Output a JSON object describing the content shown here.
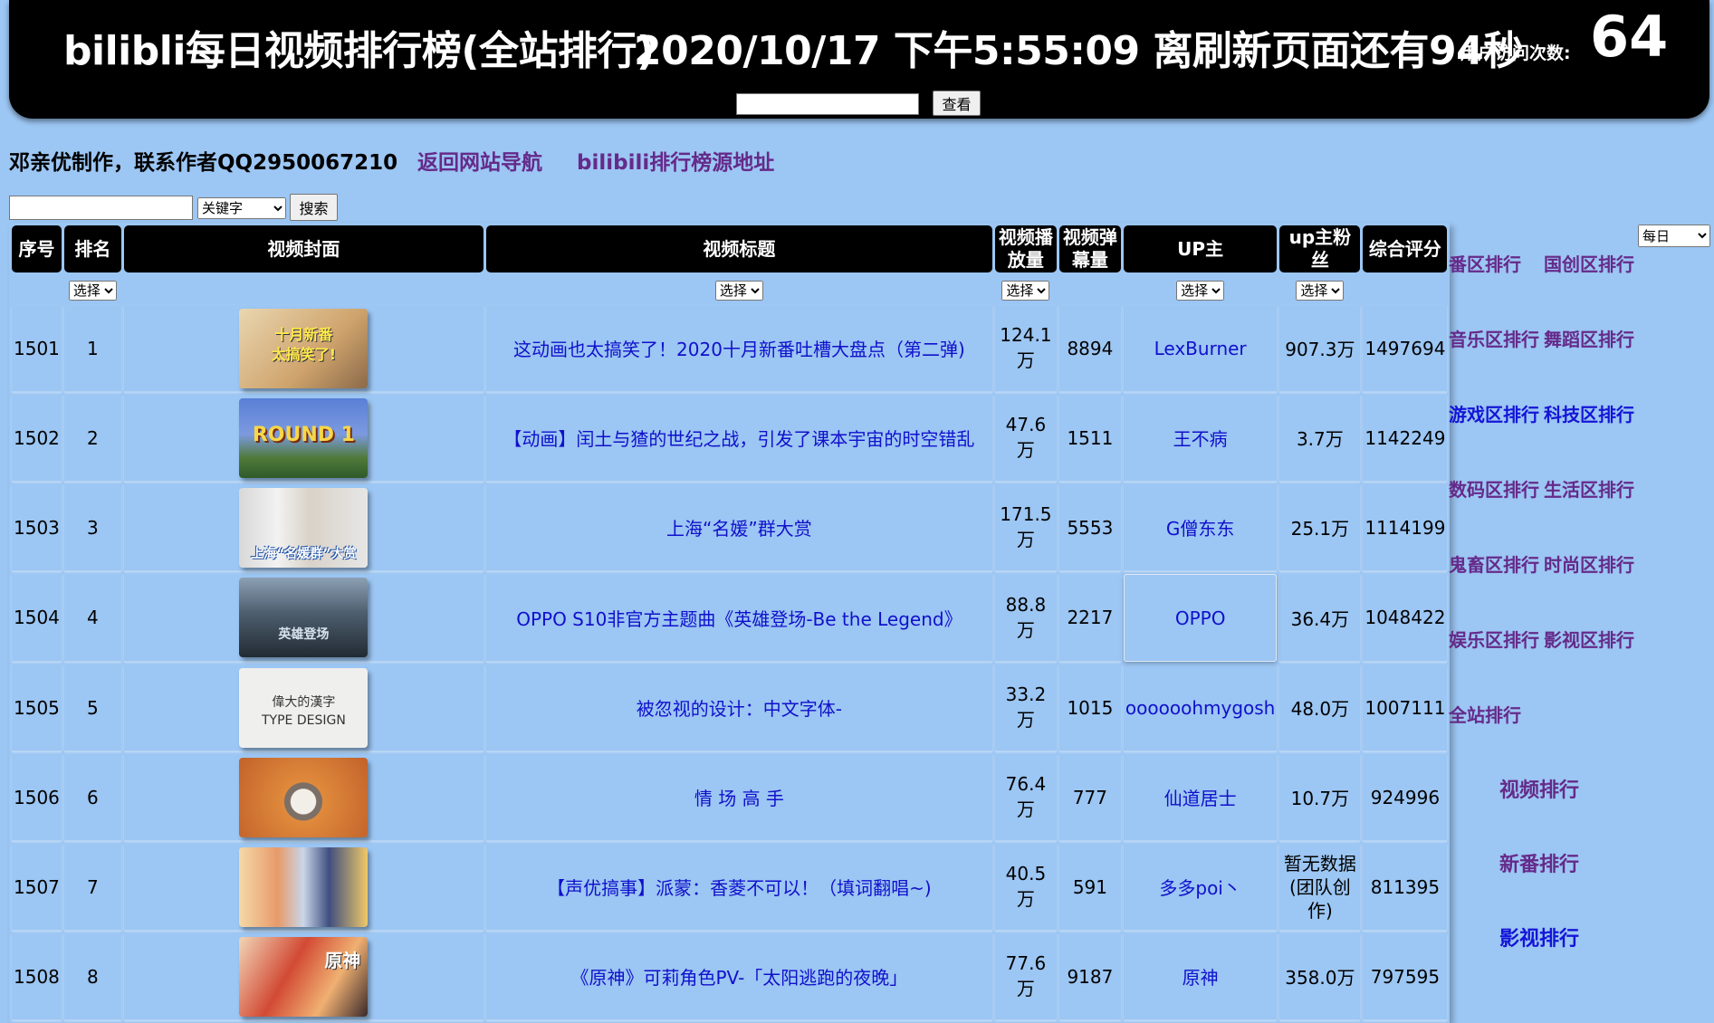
{
  "header": {
    "title": "bilibli每日视频排行榜(全站排行)",
    "clock": "2020/10/17 下午5:55:09 离刷新页面还有94秒",
    "visits_label": "用户访问次数:",
    "visits_count": "64",
    "view_button": "查看",
    "view_input_value": ""
  },
  "author": {
    "text": "邓亲优制作，联系作者QQ2950067210",
    "nav_link": "返回网站导航",
    "source_link": "bilibili排行榜源地址"
  },
  "search": {
    "input_value": "",
    "field_select": "关键字",
    "button": "搜索",
    "period_select": "每日"
  },
  "table": {
    "headers": [
      "序号",
      "排名",
      "视频封面",
      "视频标题",
      "视频播放量",
      "视频弹幕量",
      "UP主",
      "up主粉丝",
      "综合评分"
    ],
    "filter_label": "选择",
    "rows": [
      {
        "seq": "1501",
        "rank": "1",
        "title": "这动画也太搞笑了！2020十月新番吐槽大盘点（第二弹)",
        "plays": "124.1万",
        "danmaku": "8894",
        "up": "LexBurner",
        "fans": "907.3万",
        "score": "1497694",
        "thumb_text": "十月新番\n太搞笑了!"
      },
      {
        "seq": "1502",
        "rank": "2",
        "title": "【动画】闰土与猹的世纪之战，引发了课本宇宙的时空错乱",
        "plays": "47.6万",
        "danmaku": "1511",
        "up": "王不病",
        "fans": "3.7万",
        "score": "1142249",
        "thumb_text": "ROUND 1"
      },
      {
        "seq": "1503",
        "rank": "3",
        "title": "上海“名媛”群大赏",
        "plays": "171.5万",
        "danmaku": "5553",
        "up": "G僧东东",
        "fans": "25.1万",
        "score": "1114199",
        "thumb_text": "上海“名媛群”大赏"
      },
      {
        "seq": "1504",
        "rank": "4",
        "title": "OPPO S10非官方主题曲《英雄登场-Be the Legend》",
        "plays": "88.8万",
        "danmaku": "2217",
        "up": "OPPO",
        "fans": "36.4万",
        "score": "1048422",
        "thumb_text": "英雄登场"
      },
      {
        "seq": "1505",
        "rank": "5",
        "title": "被忽视的设计：中文字体-",
        "plays": "33.2万",
        "danmaku": "1015",
        "up": "oooooohmygosh",
        "fans": "48.0万",
        "score": "1007111",
        "thumb_text": "偉大的漢字\nTYPE DESIGN"
      },
      {
        "seq": "1506",
        "rank": "6",
        "title": "情 场 高 手",
        "plays": "76.4万",
        "danmaku": "777",
        "up": "仙道居士",
        "fans": "10.7万",
        "score": "924996",
        "thumb_text": ""
      },
      {
        "seq": "1507",
        "rank": "7",
        "title": "【声优搞事】派蒙：香菱不可以！（填词翻唱~)",
        "plays": "40.5万",
        "danmaku": "591",
        "up": "多多poi丶",
        "fans": "暂无数据(团队创作)",
        "score": "811395",
        "thumb_text": ""
      },
      {
        "seq": "1508",
        "rank": "8",
        "title": "《原神》可莉角色PV-「太阳逃跑的夜晚」",
        "plays": "77.6万",
        "danmaku": "9187",
        "up": "原神",
        "fans": "358.0万",
        "score": "797595",
        "thumb_text": "原神"
      }
    ]
  },
  "sidebar": {
    "items": [
      "番区排行",
      "国创区排行",
      "音乐区排行",
      "舞蹈区排行",
      "游戏区排行",
      "科技区排行",
      "数码区排行",
      "生活区排行",
      "鬼畜区排行",
      "时尚区排行",
      "娱乐区排行",
      "影视区排行",
      "全站排行",
      "视频排行",
      "新番排行",
      "影视排行"
    ]
  },
  "colors": {
    "background": "#9cc6f3",
    "banner": "#000000",
    "link_purple": "#652a8a",
    "link_blue": "#1414d8"
  }
}
